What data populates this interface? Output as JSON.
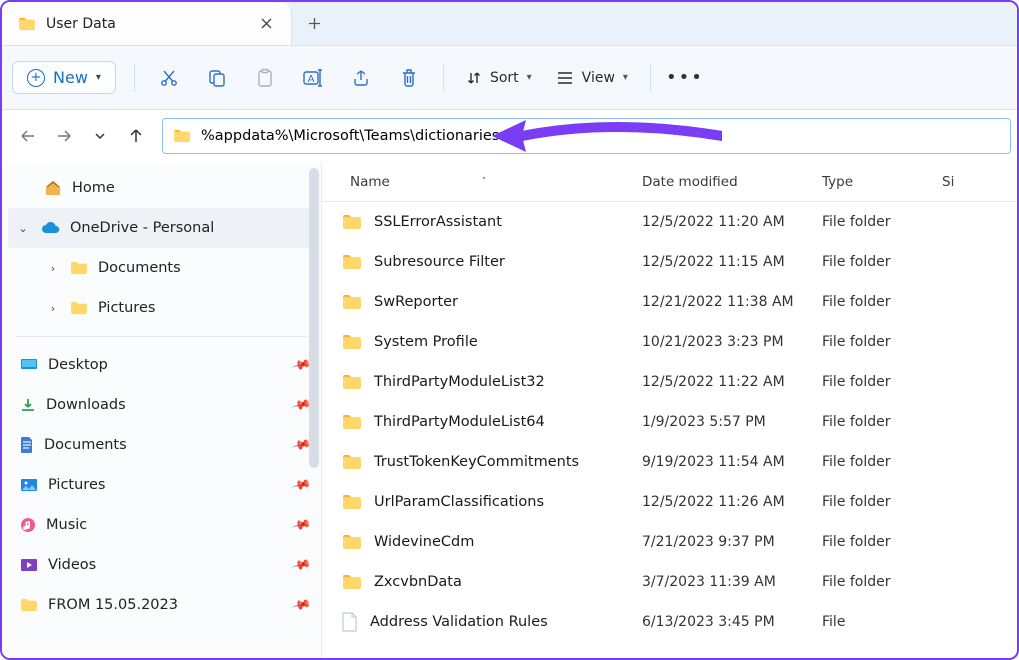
{
  "tab": {
    "title": "User Data"
  },
  "toolbar": {
    "new_label": "New",
    "sort_label": "Sort",
    "view_label": "View"
  },
  "address": {
    "path": "%appdata%\\Microsoft\\Teams\\dictionaries"
  },
  "sidebar": {
    "home": "Home",
    "onedrive": "OneDrive - Personal",
    "onedrive_children": [
      "Documents",
      "Pictures"
    ],
    "quick": [
      "Desktop",
      "Downloads",
      "Documents",
      "Pictures",
      "Music",
      "Videos",
      "FROM 15.05.2023"
    ]
  },
  "columns": {
    "name": "Name",
    "date": "Date modified",
    "type": "Type",
    "size": "Si"
  },
  "files": [
    {
      "name": "SSLErrorAssistant",
      "date": "12/5/2022 11:20 AM",
      "type": "File folder",
      "kind": "folder"
    },
    {
      "name": "Subresource Filter",
      "date": "12/5/2022 11:15 AM",
      "type": "File folder",
      "kind": "folder"
    },
    {
      "name": "SwReporter",
      "date": "12/21/2022 11:38 AM",
      "type": "File folder",
      "kind": "folder"
    },
    {
      "name": "System Profile",
      "date": "10/21/2023 3:23 PM",
      "type": "File folder",
      "kind": "folder"
    },
    {
      "name": "ThirdPartyModuleList32",
      "date": "12/5/2022 11:22 AM",
      "type": "File folder",
      "kind": "folder"
    },
    {
      "name": "ThirdPartyModuleList64",
      "date": "1/9/2023 5:57 PM",
      "type": "File folder",
      "kind": "folder"
    },
    {
      "name": "TrustTokenKeyCommitments",
      "date": "9/19/2023 11:54 AM",
      "type": "File folder",
      "kind": "folder"
    },
    {
      "name": "UrlParamClassifications",
      "date": "12/5/2022 11:26 AM",
      "type": "File folder",
      "kind": "folder"
    },
    {
      "name": "WidevineCdm",
      "date": "7/21/2023 9:37 PM",
      "type": "File folder",
      "kind": "folder"
    },
    {
      "name": "ZxcvbnData",
      "date": "3/7/2023 11:39 AM",
      "type": "File folder",
      "kind": "folder"
    },
    {
      "name": "Address Validation Rules",
      "date": "6/13/2023 3:45 PM",
      "type": "File",
      "kind": "file"
    }
  ]
}
